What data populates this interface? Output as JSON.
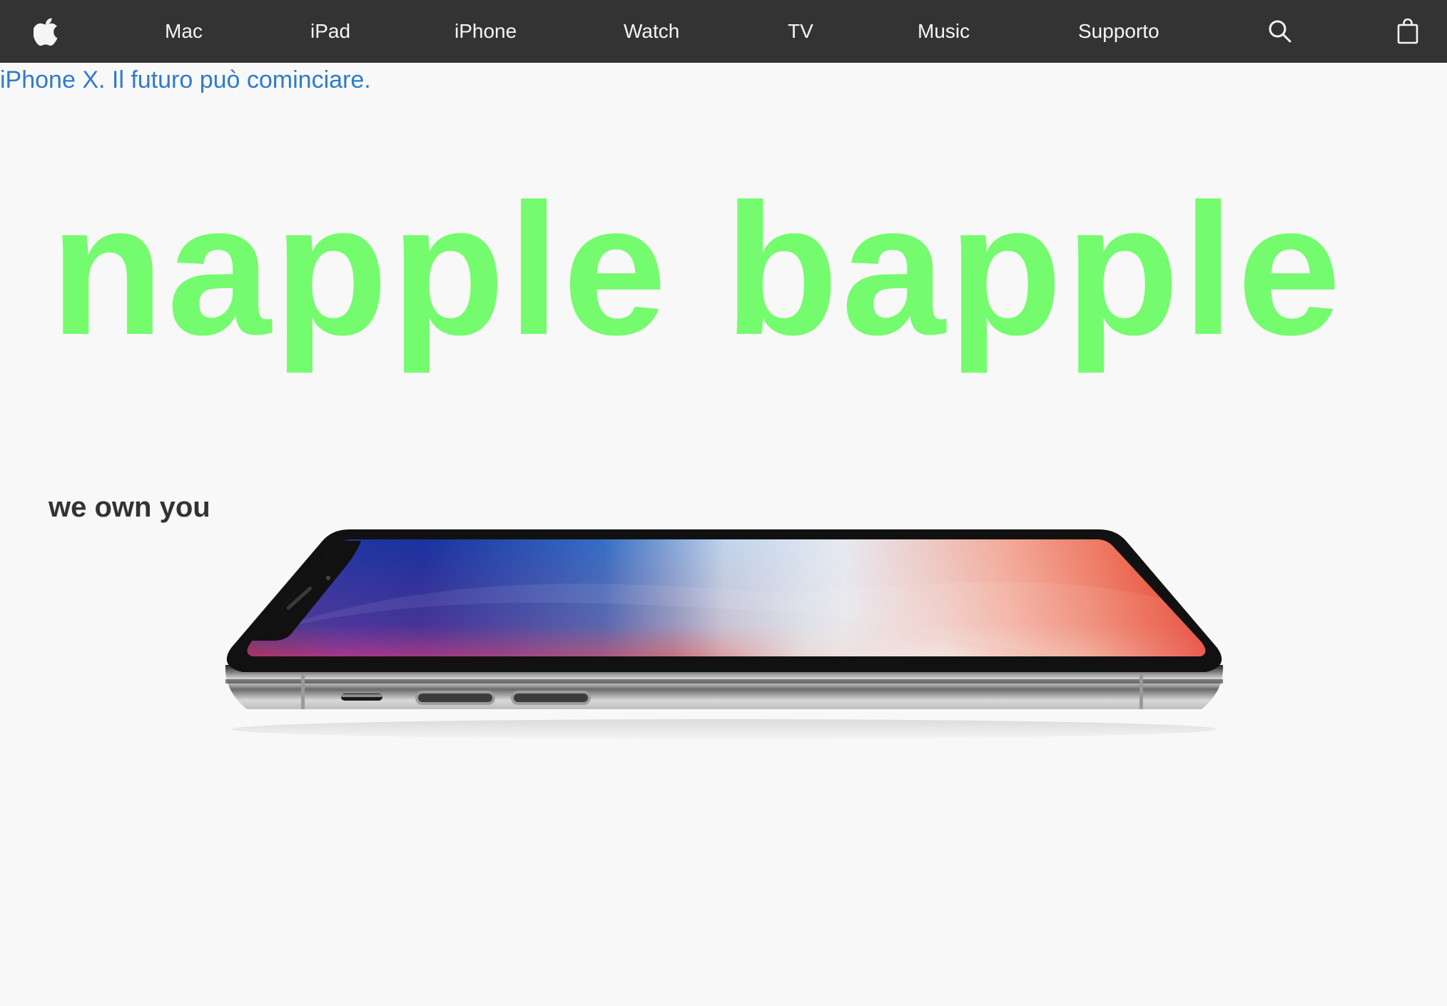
{
  "nav": {
    "logo_icon": "apple-logo-icon",
    "items": [
      {
        "label": "Mac"
      },
      {
        "label": "iPad"
      },
      {
        "label": "iPhone"
      },
      {
        "label": "Watch"
      },
      {
        "label": "TV"
      },
      {
        "label": "Music"
      },
      {
        "label": "Supporto"
      }
    ],
    "search_icon": "search-icon",
    "bag_icon": "shopping-bag-icon"
  },
  "promo": {
    "link_text": "iPhone X. Il futuro può cominciare."
  },
  "hero": {
    "title": "napple bapple",
    "tagline": "we own you",
    "image": "iphone-x-product-image"
  },
  "colors": {
    "nav_background": "#333333",
    "nav_text": "#f5f5f7",
    "page_background": "#f8f8f8",
    "link": "#2f7bcb",
    "hero_title": "#75fb6e",
    "tagline": "#333333"
  }
}
